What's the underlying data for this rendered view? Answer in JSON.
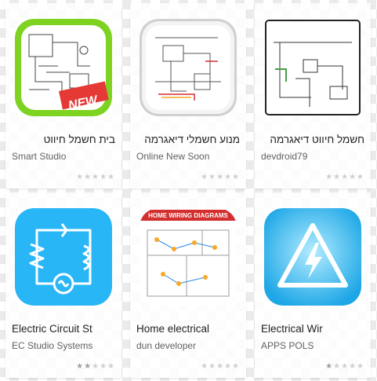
{
  "apps": [
    {
      "title": "בית חשמל חיווט",
      "developer": "Smart Studio",
      "badge": "NEW",
      "rating": 0,
      "rtl": true
    },
    {
      "title": "מנוע חשמלי דיאגרמה",
      "developer": "Online New Soon",
      "rating": 0,
      "rtl": true
    },
    {
      "title": "חשמל חיווט דיאגרמה",
      "developer": "devdroid79",
      "rating": 0,
      "rtl": true
    },
    {
      "title": "Electric Circuit St",
      "developer": "EC Studio Systems",
      "rating": 2,
      "rtl": false
    },
    {
      "title": "Home electrical",
      "developer": "dun developer",
      "banner": "HOME WIRING DIAGRAMS",
      "rating": 0,
      "rtl": false
    },
    {
      "title": "Electrical Wir",
      "developer": "APPS POLS",
      "rating": 1,
      "rtl": false
    }
  ],
  "colors": {
    "green_border": "#7ed321",
    "new_badge": "#e53935",
    "cyan": "#29b6f6",
    "banner_red": "#d32f2f"
  },
  "icons": [
    "wiring-diagram-icon",
    "wiring-diagram-icon",
    "wiring-diagram-icon",
    "circuit-icon",
    "house-wiring-icon",
    "high-voltage-icon"
  ]
}
